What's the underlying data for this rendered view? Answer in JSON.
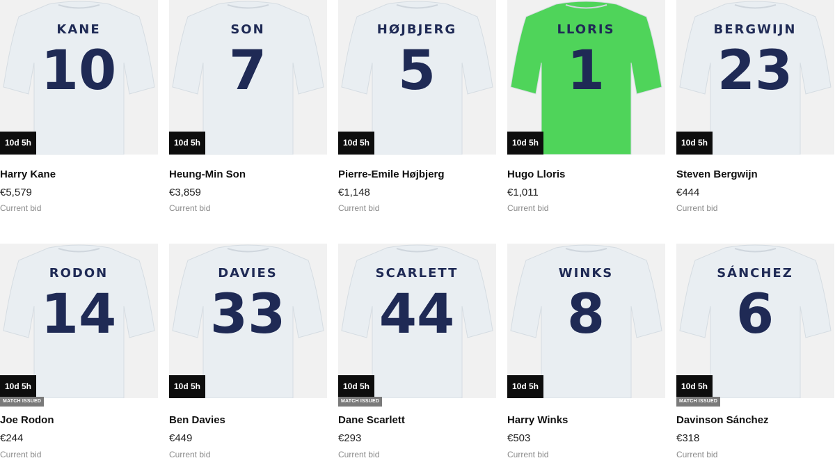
{
  "products": [
    {
      "name": "Harry Kane",
      "price": "€5,579",
      "bid_label": "Current bid",
      "timer": "10d 5h",
      "shirt_name": "KANE",
      "shirt_number": "10",
      "shirt_color": "#e9eef2",
      "badge": ""
    },
    {
      "name": "Heung-Min Son",
      "price": "€3,859",
      "bid_label": "Current bid",
      "timer": "10d 5h",
      "shirt_name": "SON",
      "shirt_number": "7",
      "shirt_color": "#e9eef2",
      "badge": ""
    },
    {
      "name": "Pierre-Emile Højbjerg",
      "price": "€1,148",
      "bid_label": "Current bid",
      "timer": "10d 5h",
      "shirt_name": "HØJBJERG",
      "shirt_number": "5",
      "shirt_color": "#e9eef2",
      "badge": ""
    },
    {
      "name": "Hugo Lloris",
      "price": "€1,011",
      "bid_label": "Current bid",
      "timer": "10d 5h",
      "shirt_name": "LLORIS",
      "shirt_number": "1",
      "shirt_color": "#4fd45a",
      "badge": ""
    },
    {
      "name": "Steven Bergwijn",
      "price": "€444",
      "bid_label": "Current bid",
      "timer": "10d 5h",
      "shirt_name": "BERGWIJN",
      "shirt_number": "23",
      "shirt_color": "#e9eef2",
      "badge": ""
    },
    {
      "name": "Joe Rodon",
      "price": "€244",
      "bid_label": "Current bid",
      "timer": "10d 5h",
      "shirt_name": "RODON",
      "shirt_number": "14",
      "shirt_color": "#e9eef2",
      "badge": "MATCH ISSUED"
    },
    {
      "name": "Ben Davies",
      "price": "€449",
      "bid_label": "Current bid",
      "timer": "10d 5h",
      "shirt_name": "DAVIES",
      "shirt_number": "33",
      "shirt_color": "#e9eef2",
      "badge": ""
    },
    {
      "name": "Dane Scarlett",
      "price": "€293",
      "bid_label": "Current bid",
      "timer": "10d 5h",
      "shirt_name": "SCARLETT",
      "shirt_number": "44",
      "shirt_color": "#e9eef2",
      "badge": "MATCH ISSUED"
    },
    {
      "name": "Harry Winks",
      "price": "€503",
      "bid_label": "Current bid",
      "timer": "10d 5h",
      "shirt_name": "WINKS",
      "shirt_number": "8",
      "shirt_color": "#e9eef2",
      "badge": ""
    },
    {
      "name": "Davinson Sánchez",
      "price": "€318",
      "bid_label": "Current bid",
      "timer": "10d 5h",
      "shirt_name": "SÁNCHEZ",
      "shirt_number": "6",
      "shirt_color": "#e9eef2",
      "badge": "MATCH ISSUED"
    }
  ],
  "colors": {
    "ink": "#1f2a55",
    "timer_bg": "#0d0d0d",
    "badge_bg": "#7a7a7a",
    "image_bg": "#f1f1f1"
  }
}
